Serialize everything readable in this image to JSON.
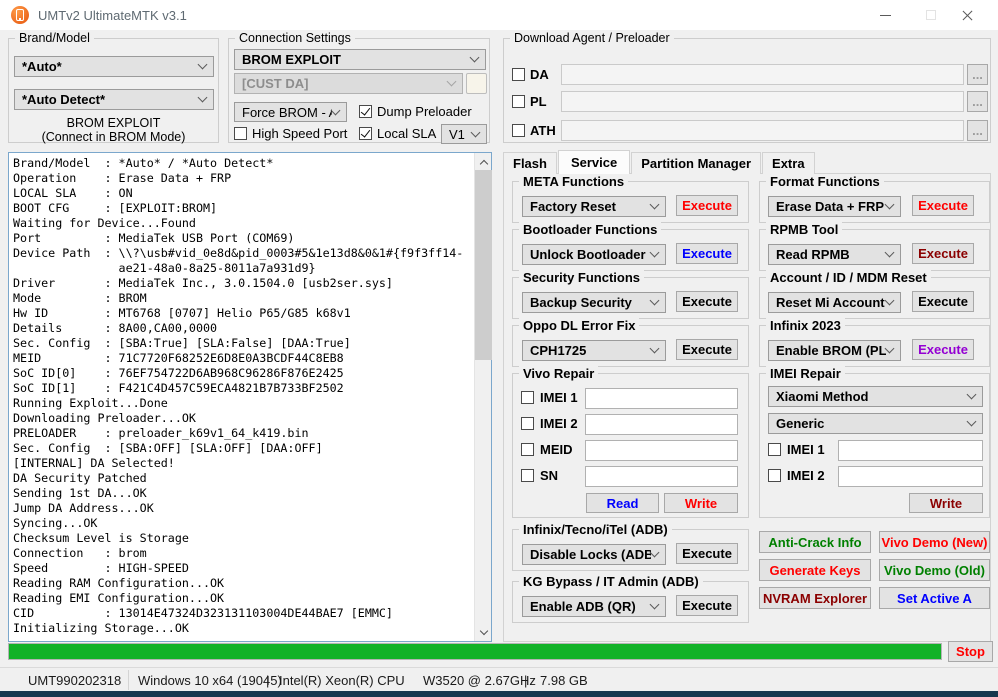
{
  "window": {
    "title": "UMTv2 UltimateMTK v3.1"
  },
  "brand_model": {
    "label": "Brand/Model",
    "brand_value": "*Auto*",
    "model_value": "*Auto Detect*",
    "note_line1": "BROM EXPLOIT",
    "note_line2": "(Connect in BROM Mode)"
  },
  "connection": {
    "label": "Connection Settings",
    "boot_mode": "BROM EXPLOIT",
    "cust_da": "[CUST DA]",
    "force_brom": "Force BROM - Auto",
    "dump_preloader": {
      "label": "Dump Preloader",
      "checked": true
    },
    "high_speed_port": {
      "label": "High Speed Port",
      "checked": false
    },
    "local_sla": {
      "label": "Local SLA",
      "checked": true
    },
    "sla_version": "V1"
  },
  "download_agent": {
    "label": "Download Agent / Preloader",
    "browse_label": "...",
    "rows": [
      {
        "label": "DA",
        "checked": false,
        "value": ""
      },
      {
        "label": "PL",
        "checked": false,
        "value": ""
      },
      {
        "label": "ATH",
        "checked": false,
        "value": ""
      }
    ]
  },
  "log": {
    "lines": [
      "Brand/Model  : *Auto* / *Auto Detect*",
      "Operation    : Erase Data + FRP",
      "LOCAL SLA    : ON",
      "BOOT CFG     : [EXPLOIT:BROM]",
      "Waiting for Device...Found",
      "Port         : MediaTek USB Port (COM69)",
      "Device Path  : \\\\?\\usb#vid_0e8d&pid_0003#5&1e13d8&0&1#{f9f3ff14-",
      "               ae21-48a0-8a25-8011a7a931d9}",
      "Driver       : MediaTek Inc., 3.0.1504.0 [usb2ser.sys]",
      "Mode         : BROM",
      "Hw ID        : MT6768 [0707] Helio P65/G85 k68v1",
      "Details      : 8A00,CA00,0000",
      "Sec. Config  : [SBA:True] [SLA:False] [DAA:True]",
      "MEID         : 71C7720F68252E6D8E0A3BCDF44C8EB8",
      "SoC ID[0]    : 76EF754722D6AB968C96286F876E2425",
      "SoC ID[1]    : F421C4D457C59ECA4821B7B733BF2502",
      "Running Exploit...Done",
      "Downloading Preloader...OK",
      "PRELOADER    : preloader_k69v1_64_k419.bin",
      "Sec. Config  : [SBA:OFF] [SLA:OFF] [DAA:OFF]",
      "[INTERNAL] DA Selected!",
      "DA Security Patched",
      "Sending 1st DA...OK",
      "Jump DA Address...OK",
      "Syncing...OK",
      "Checksum Level is Storage",
      "Connection   : brom",
      "Speed        : HIGH-SPEED",
      "Reading RAM Configuration...OK",
      "Reading EMI Configuration...OK",
      "CID          : 13014E47324D323131103004DE44BAE7 [EMMC]",
      "Initializing Storage...OK"
    ]
  },
  "tabs": {
    "active": "Service",
    "items": [
      {
        "label": "Flash"
      },
      {
        "label": "Service"
      },
      {
        "label": "Partition Manager"
      },
      {
        "label": "Extra"
      }
    ]
  },
  "service": {
    "meta": {
      "label": "META Functions",
      "value": "Factory Reset",
      "button": "Execute",
      "button_color": "#ff0000"
    },
    "bootloader": {
      "label": "Bootloader Functions",
      "value": "Unlock Bootloader",
      "button": "Execute",
      "button_color": "#0000ff"
    },
    "security": {
      "label": "Security Functions",
      "value": "Backup Security",
      "button": "Execute",
      "button_color": "#000000"
    },
    "oppo": {
      "label": "Oppo DL Error Fix",
      "value": "CPH1725",
      "button": "Execute",
      "button_color": "#000000"
    },
    "vivo_repair": {
      "label": "Vivo Repair",
      "rows": [
        {
          "label": "IMEI 1",
          "checked": false,
          "value": ""
        },
        {
          "label": "IMEI 2",
          "checked": false,
          "value": ""
        },
        {
          "label": "MEID",
          "checked": false,
          "value": ""
        },
        {
          "label": "SN",
          "checked": false,
          "value": ""
        }
      ],
      "read_button": "Read",
      "read_color": "#0000ff",
      "write_button": "Write",
      "write_color": "#ff0000"
    },
    "infinix_adb": {
      "label": "Infinix/Tecno/iTel (ADB)",
      "value": "Disable Locks (ADB)",
      "button": "Execute",
      "button_color": "#000000"
    },
    "kg_bypass": {
      "label": "KG Bypass / IT Admin (ADB)",
      "value": "Enable ADB (QR)",
      "button": "Execute",
      "button_color": "#000000"
    },
    "format": {
      "label": "Format Functions",
      "value": "Erase Data + FRP",
      "button": "Execute",
      "button_color": "#ff0000"
    },
    "rpmb": {
      "label": "RPMB Tool",
      "value": "Read RPMB",
      "button": "Execute",
      "button_color": "#8b0000"
    },
    "account": {
      "label": "Account / ID / MDM Reset",
      "value": "Reset Mi Account",
      "button": "Execute",
      "button_color": "#000000"
    },
    "infinix_2023": {
      "label": "Infinix 2023",
      "value": "Enable BROM (PL)",
      "button": "Execute",
      "button_color": "#9400d3"
    },
    "imei_repair": {
      "label": "IMEI Repair",
      "method": "Xiaomi Method",
      "variant": "Generic",
      "rows": [
        {
          "label": "IMEI 1",
          "checked": false,
          "value": ""
        },
        {
          "label": "IMEI 2",
          "checked": false,
          "value": ""
        }
      ],
      "write_button": "Write",
      "write_color": "#8b0000"
    },
    "actions": [
      {
        "label": "Anti-Crack Info",
        "color": "#008000"
      },
      {
        "label": "Vivo Demo (New)",
        "color": "#ff0000"
      },
      {
        "label": "Generate Keys",
        "color": "#ff0000"
      },
      {
        "label": "Vivo Demo (Old)",
        "color": "#008000"
      },
      {
        "label": "NVRAM Explorer",
        "color": "#8b0000"
      },
      {
        "label": "Set Active A",
        "color": "#0000ff"
      }
    ]
  },
  "progress": {
    "percent": 100,
    "color": "#12b228"
  },
  "footer": {
    "stop_label": "Stop",
    "stop_color": "#ff0000",
    "serial": "UMT990202318",
    "os": "Windows 10 x64 (19045)",
    "sep1": "|",
    "cpu": "Intel(R) Xeon(R) CPU",
    "cpu_speed": "W3520  @ 2.67GHz",
    "sep2": "|",
    "ram": "7.98 GB"
  }
}
